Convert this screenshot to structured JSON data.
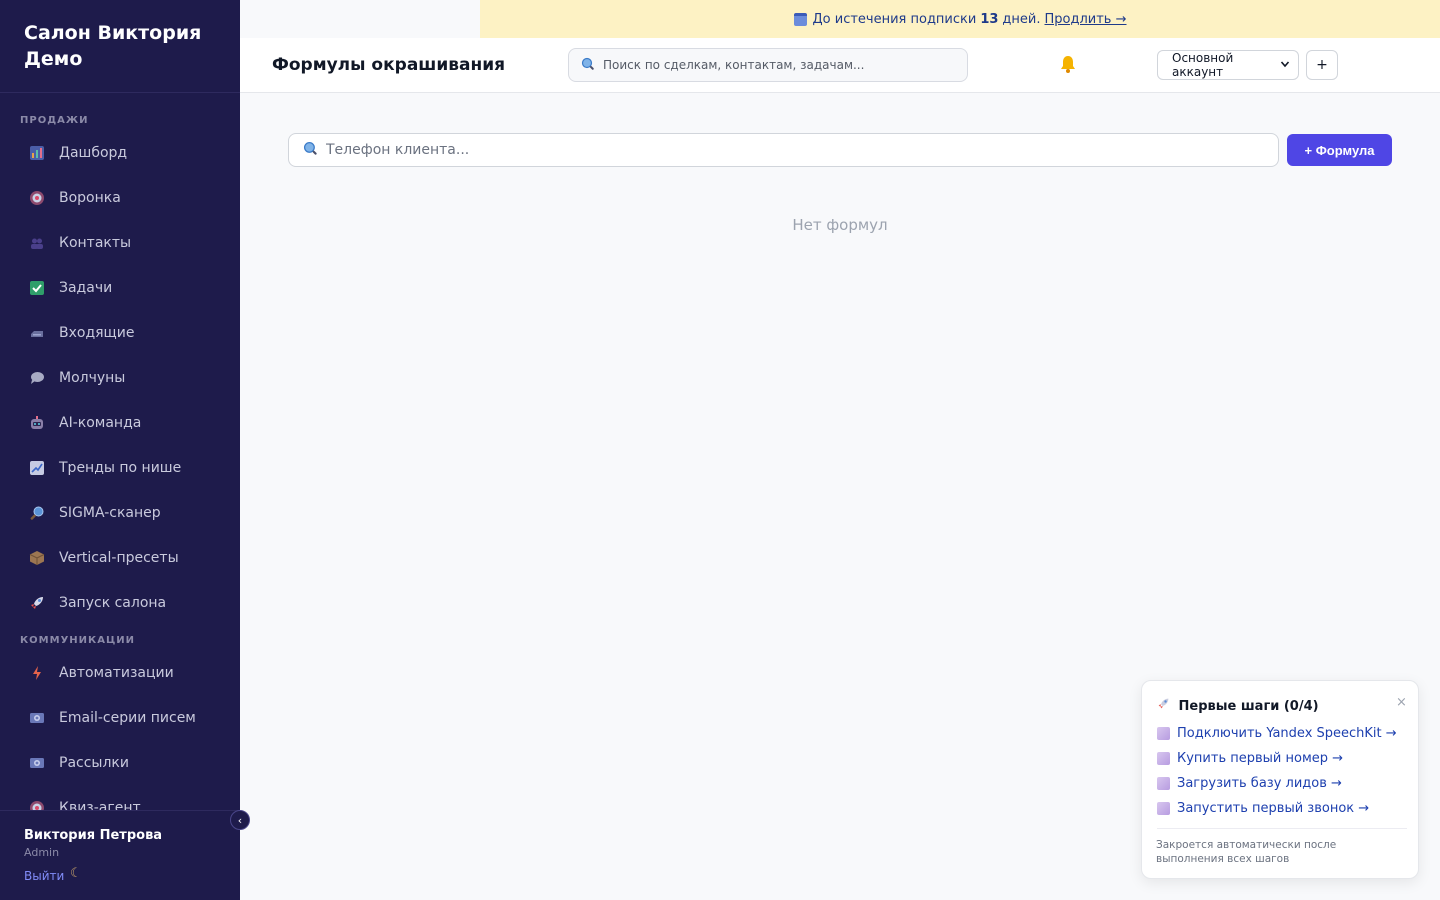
{
  "brand": {
    "line1": "Салон Виктория",
    "line2": "Демо"
  },
  "sidebar": {
    "sections": [
      {
        "label": "ПРОДАЖИ"
      },
      {
        "label": "КОММУНИКАЦИИ"
      }
    ],
    "items": [
      {
        "label": "Дашборд",
        "icon": "bar-chart-icon"
      },
      {
        "label": "Воронка",
        "icon": "target-icon"
      },
      {
        "label": "Контакты",
        "icon": "users-icon"
      },
      {
        "label": "Задачи",
        "icon": "checkbox-icon"
      },
      {
        "label": "Входящие",
        "icon": "inbox-icon"
      },
      {
        "label": "Молчуны",
        "icon": "speech-bubble-icon"
      },
      {
        "label": "AI-команда",
        "icon": "robot-icon"
      },
      {
        "label": "Тренды по нише",
        "icon": "trend-chart-icon"
      },
      {
        "label": "SIGMA-сканер",
        "icon": "magnifier-icon"
      },
      {
        "label": "Vertical-пресеты",
        "icon": "package-icon"
      },
      {
        "label": "Запуск салона",
        "icon": "rocket-icon"
      },
      {
        "label": "Автоматизации",
        "icon": "lightning-icon"
      },
      {
        "label": "Email-серии писем",
        "icon": "email-icon"
      },
      {
        "label": "Рассылки",
        "icon": "broadcast-icon"
      },
      {
        "label": "Квиз-агент",
        "icon": "quiz-icon"
      }
    ],
    "collapse_glyph": "‹",
    "user": {
      "name": "Виктория Петрова",
      "role": "Admin"
    },
    "logout_label": "Выйти",
    "theme_glyph": "☾"
  },
  "banner": {
    "prefix": "До истечения подписки",
    "days": "13",
    "suffix": "дней.",
    "link": "Продлить →"
  },
  "header": {
    "title": "Формулы окрашивания",
    "search_placeholder": "Поиск по сделкам, контактам, задачам...",
    "account": "Основной аккаунт",
    "plus": "+"
  },
  "main": {
    "client_search_placeholder": "Телефон клиента...",
    "add_button": "+ Формула",
    "empty": "Нет формул"
  },
  "onboarding": {
    "title": "Первые шаги (0/4)",
    "close": "×",
    "steps": [
      "Подключить Yandex SpeechKit →",
      "Купить первый номер →",
      "Загрузить базу лидов →",
      "Запустить первый звонок →"
    ],
    "footer": "Закроется автоматически после выполнения всех шагов"
  },
  "colors": {
    "sidebar_bg": "#1e1b4b",
    "accent": "#4f46e5",
    "banner_bg": "#fdf2c4",
    "link": "#1e40af"
  }
}
